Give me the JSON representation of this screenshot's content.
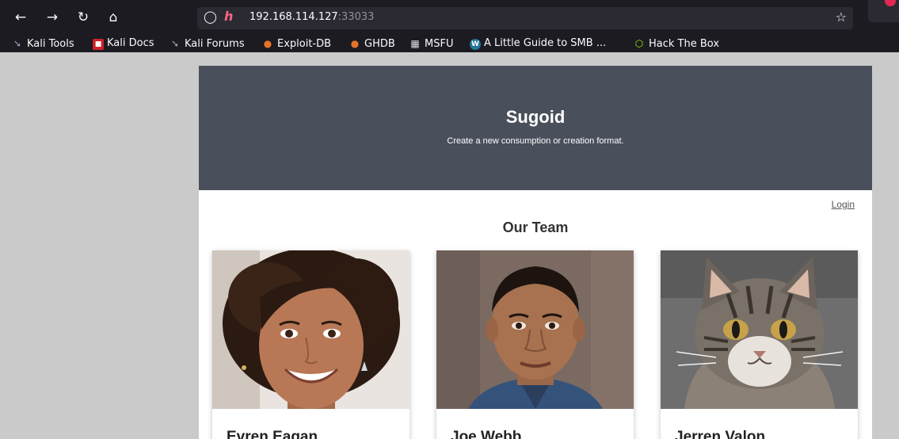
{
  "browser": {
    "url_host": "192.168.114.127",
    "url_port": ":33033",
    "bookmarks": [
      {
        "label": "Kali Tools",
        "icon": "kali-dragon-icon"
      },
      {
        "label": "Kali Docs",
        "icon": "kali-docs-icon"
      },
      {
        "label": "Kali Forums",
        "icon": "kali-dragon-icon"
      },
      {
        "label": "Exploit-DB",
        "icon": "exploit-db-icon"
      },
      {
        "label": "GHDB",
        "icon": "ghdb-icon"
      },
      {
        "label": "MSFU",
        "icon": "msfu-icon"
      },
      {
        "label": "A Little Guide to SMB ...",
        "icon": "wordpress-icon"
      },
      {
        "label": "Hack The Box",
        "icon": "hackthebox-icon"
      }
    ]
  },
  "site": {
    "title": "Sugoid",
    "tagline": "Create a new consumption or creation format.",
    "login_label": "Login",
    "team_heading": "Our Team",
    "team": [
      {
        "name": "Evren Eagan",
        "photo": "woman-portrait"
      },
      {
        "name": "Joe Webb",
        "photo": "man-portrait"
      },
      {
        "name": "Jerren Valon",
        "photo": "tabby-cat-portrait"
      }
    ]
  },
  "colors": {
    "hero_bg": "#4a4f5c",
    "page_bg": "#cacaca",
    "browser_bg": "#1c1b22"
  }
}
